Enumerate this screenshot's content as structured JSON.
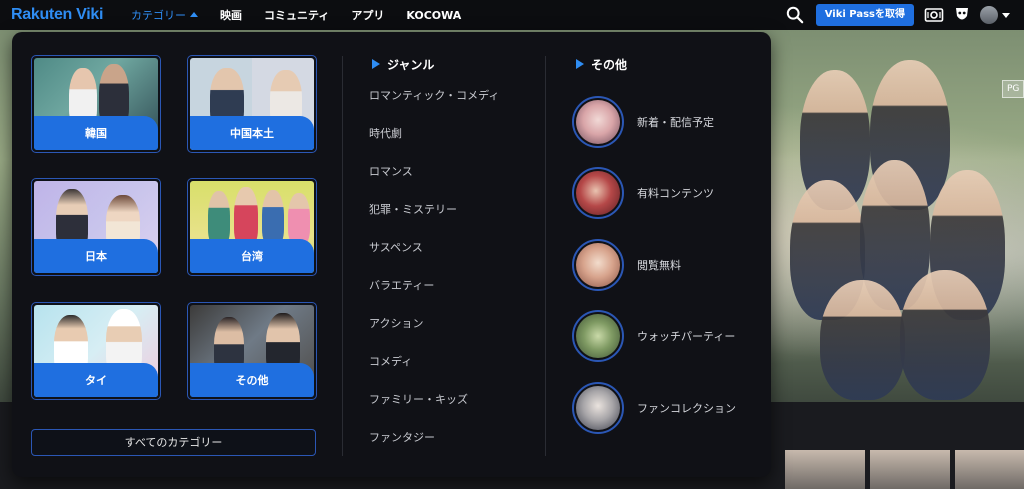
{
  "app": {
    "logo_text": "Rakuten Viki",
    "brand_color": "#2f8df3",
    "accent_button_color": "#1f6fe0"
  },
  "nav": {
    "items": [
      {
        "label": "カテゴリー",
        "active": true,
        "icon": "caret-up-icon"
      },
      {
        "label": "映画"
      },
      {
        "label": "コミュニティ"
      },
      {
        "label": "アプリ"
      },
      {
        "label": "KOCOWA"
      }
    ]
  },
  "toolbar": {
    "search_icon": "search-icon",
    "pass_button_label": "Viki Passを取得",
    "icons": [
      "ticket-icon",
      "mask-icon",
      "avatar",
      "chevron-down-icon"
    ]
  },
  "hero": {
    "badge_text": "PG"
  },
  "categories": {
    "cards": [
      {
        "label": "韓国"
      },
      {
        "label": "中国本土"
      },
      {
        "label": "日本"
      },
      {
        "label": "台湾"
      },
      {
        "label": "タイ"
      },
      {
        "label": "その他"
      }
    ],
    "all_button_label": "すべてのカテゴリー"
  },
  "genres": {
    "title": "ジャンル",
    "items": [
      "ロマンティック・コメディ",
      "時代劇",
      "ロマンス",
      "犯罪・ミステリー",
      "サスペンス",
      "バラエティー",
      "アクション",
      "コメディ",
      "ファミリー・キッズ",
      "ファンタジー"
    ]
  },
  "others": {
    "title": "その他",
    "items": [
      "新着・配信予定",
      "有料コンテンツ",
      "閲覧無料",
      "ウォッチパーティー",
      "ファンコレクション"
    ]
  }
}
